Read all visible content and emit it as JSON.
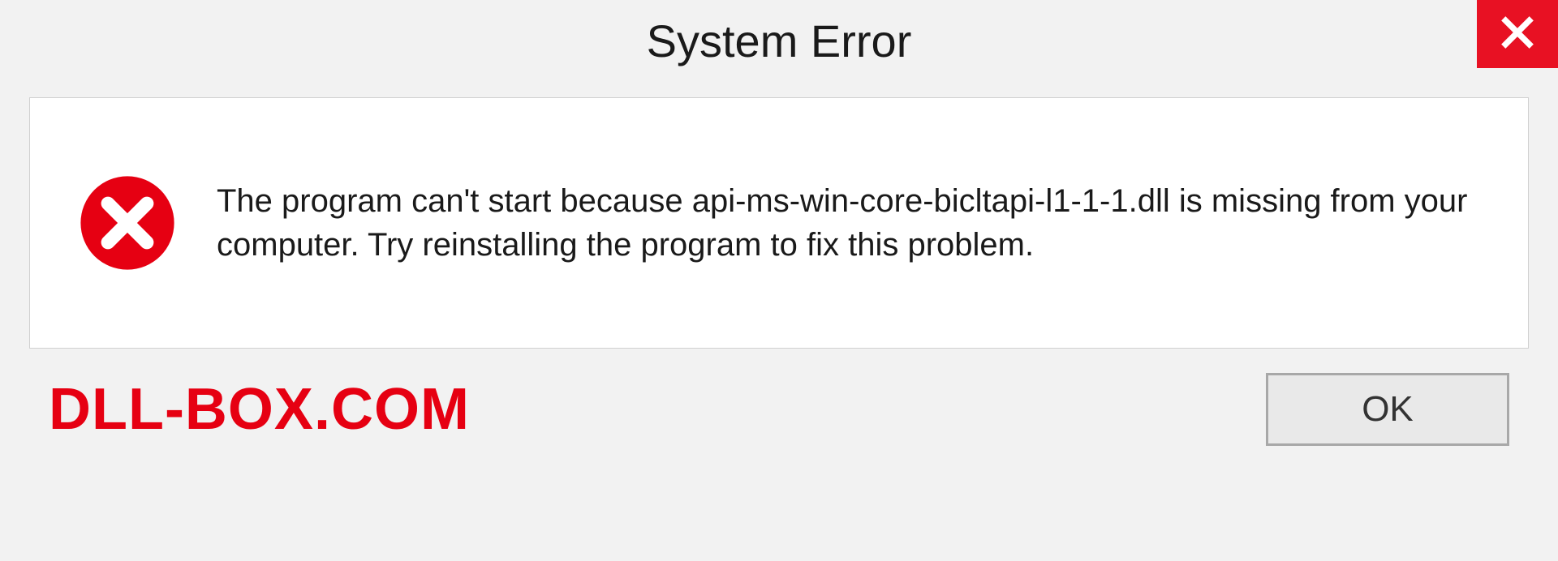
{
  "dialog": {
    "title": "System Error",
    "message": "The program can't start because api-ms-win-core-bicltapi-l1-1-1.dll is missing from your computer. Try reinstalling the program to fix this problem.",
    "ok_label": "OK"
  },
  "watermark": "DLL-BOX.COM",
  "colors": {
    "close_bg": "#e81123",
    "error_red": "#e60012"
  }
}
